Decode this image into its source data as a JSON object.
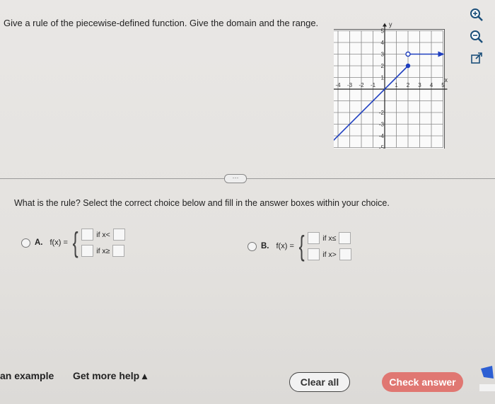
{
  "question": "Give a rule of the piecewise-defined function. Give the domain and the range.",
  "graph": {
    "x_axis_label": "x",
    "y_axis_label": "y",
    "x_ticks_neg": [
      "-5",
      "-4",
      "-3",
      "-2",
      "-1"
    ],
    "x_ticks_pos": [
      "1",
      "2",
      "3",
      "4",
      "5"
    ],
    "y_ticks_pos": [
      "5",
      "4",
      "3",
      "2",
      "1"
    ],
    "y_ticks_neg": [
      "-2",
      "-3",
      "-4",
      "-5"
    ],
    "segments": [
      {
        "description": "line",
        "from": [
          -5,
          -5
        ],
        "to": [
          2,
          2
        ],
        "start": "arrow",
        "end": "closed-dot"
      },
      {
        "description": "ray",
        "from": [
          2,
          3
        ],
        "to": [
          5,
          3
        ],
        "start": "open-dot",
        "end": "arrow"
      }
    ],
    "color": "#1f3fbf"
  },
  "side_icons": [
    "zoom-in-icon",
    "zoom-out-icon",
    "external-link-icon"
  ],
  "expand_label": "···",
  "prompt": "What is the rule? Select the correct choice below and fill in the answer boxes within your choice.",
  "choices": [
    {
      "letter": "A.",
      "fx": "f(x) =",
      "cond1": "if x<",
      "cond2": "if x≥"
    },
    {
      "letter": "B.",
      "fx": "f(x) =",
      "cond1": "if x≤",
      "cond2": "if x>"
    }
  ],
  "bottom": {
    "example": "an example",
    "help": "Get more help ▴",
    "clear": "Clear all",
    "check": "Check answer"
  }
}
